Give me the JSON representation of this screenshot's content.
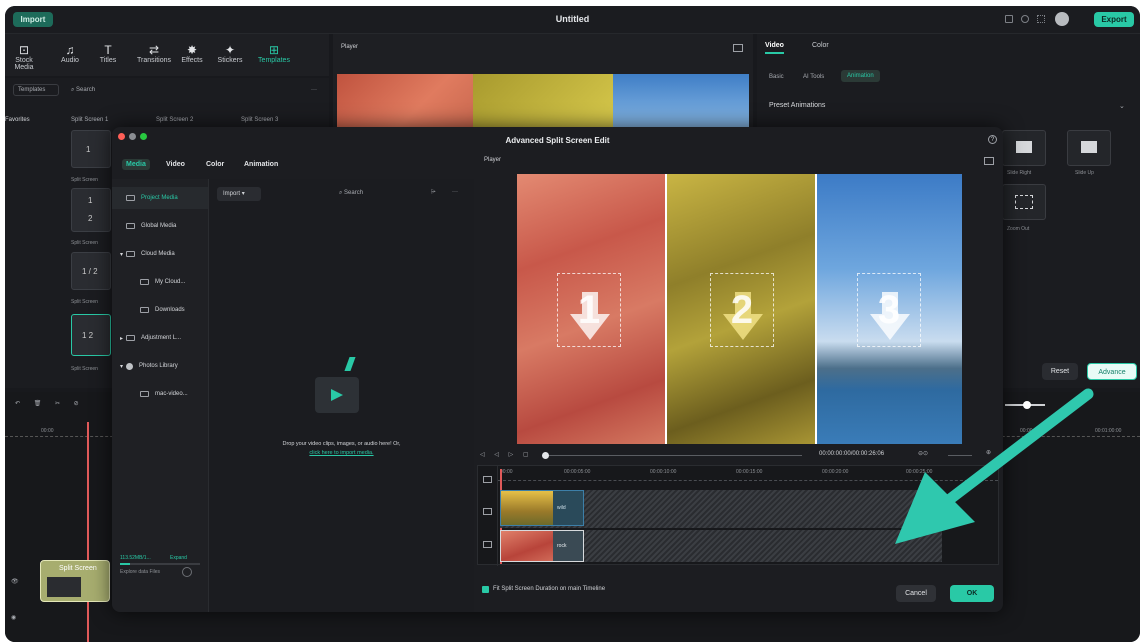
{
  "app": {
    "title": "Untitled",
    "import_label": "Import",
    "export_label": "Export"
  },
  "toolbar": [
    {
      "label": "Stock Media",
      "icon": "stock-media-icon",
      "glyph": "⊡"
    },
    {
      "label": "Audio",
      "icon": "music-note-icon",
      "glyph": "♫"
    },
    {
      "label": "Titles",
      "icon": "text-icon",
      "glyph": "T"
    },
    {
      "label": "Transitions",
      "icon": "transitions-icon",
      "glyph": "⇄"
    },
    {
      "label": "Effects",
      "icon": "effects-icon",
      "glyph": "✸"
    },
    {
      "label": "Stickers",
      "icon": "stickers-icon",
      "glyph": "✦"
    },
    {
      "label": "Templates",
      "icon": "templates-icon",
      "glyph": "⊞"
    }
  ],
  "left_panel": {
    "templates_tab": "Templates",
    "search_placeholder": "Search",
    "favorites": "Favorites",
    "split_labels": [
      "Split Screen 1",
      "Split Screen 2",
      "Split Screen 3"
    ],
    "split_short": [
      "Split Screen",
      "Split Screen",
      "Split Screen",
      "Split Screen"
    ]
  },
  "player": {
    "label": "Player"
  },
  "right_panel": {
    "tabs": [
      "Video",
      "Color"
    ],
    "subtabs": [
      "Basic",
      "AI Tools",
      "Animation"
    ],
    "preset_title": "Preset Animations",
    "presets": [
      "Slide Right",
      "Slide Up",
      "Zoom Out"
    ],
    "reset": "Reset",
    "advance": "Advance"
  },
  "timeline": {
    "times": [
      "00:00",
      "00:00:05:00",
      "00:01:00:00"
    ],
    "clip_label": "Split Screen"
  },
  "modal": {
    "title": "Advanced Split Screen Edit",
    "tabs": [
      "Media",
      "Video",
      "Color",
      "Animation"
    ],
    "sidebar": [
      "Project Media",
      "Global Media",
      "Cloud Media",
      "My Cloud...",
      "Downloads",
      "Adjustment L...",
      "Photos Library",
      "mac-video..."
    ],
    "storage": "113.52MB/1...",
    "expand": "Expand",
    "explore": "Explore data Files",
    "import_btn": "Import",
    "search_placeholder": "Search",
    "drop_text": "Drop your video clips, images, or audio here! Or,",
    "drop_link": "click here to import media.",
    "player_label": "Player",
    "timecode": "00:00:00:00/00:00:26:06",
    "tl_ticks": [
      "00:00",
      "00:00:05:00",
      "00:00:10:00",
      "00:00:15:00",
      "00:00:20:00",
      "00:00:25:00"
    ],
    "clip_labels": [
      "wild",
      "rock"
    ],
    "numbers": [
      "1",
      "2",
      "3"
    ],
    "fit_label": "Fit Split Screen Duration on main Timeline",
    "cancel": "Cancel",
    "ok": "OK"
  },
  "colors": {
    "accent": "#29c9a6",
    "background": "#18191d",
    "arrow": "#2fc8ae"
  }
}
